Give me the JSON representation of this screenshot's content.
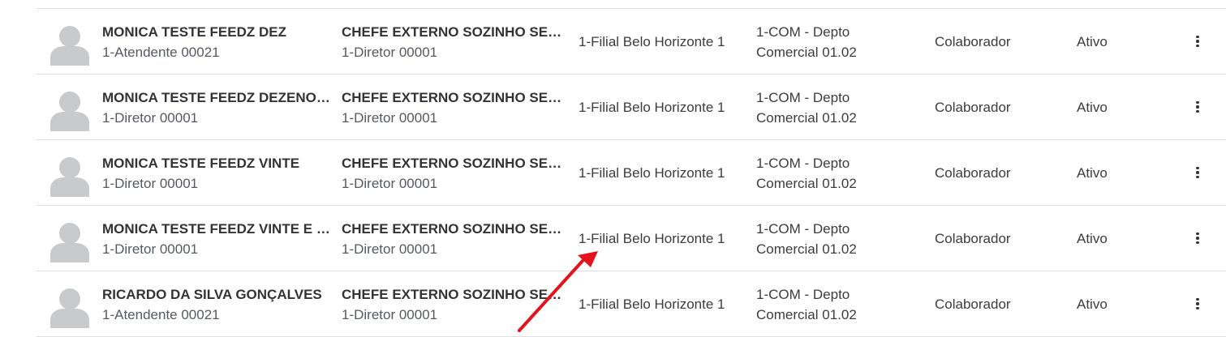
{
  "rows": [
    {
      "name": "MONICA TESTE FEEDZ DEZ",
      "position": "1-Atendente 00021",
      "manager": "CHEFE EXTERNO SOZINHO SEM...",
      "manager_position": "1-Diretor 00001",
      "branch": "1-Filial Belo Horizonte 1",
      "dept_line1": "1-COM - Depto",
      "dept_line2": "Comercial 01.02",
      "role": "Colaborador",
      "status": "Ativo"
    },
    {
      "name": "MONICA TESTE FEEDZ DEZENOVE",
      "position": "1-Diretor 00001",
      "manager": "CHEFE EXTERNO SOZINHO SEM...",
      "manager_position": "1-Diretor 00001",
      "branch": "1-Filial Belo Horizonte 1",
      "dept_line1": "1-COM - Depto",
      "dept_line2": "Comercial 01.02",
      "role": "Colaborador",
      "status": "Ativo"
    },
    {
      "name": "MONICA TESTE FEEDZ VINTE",
      "position": "1-Diretor 00001",
      "manager": "CHEFE EXTERNO SOZINHO SEM...",
      "manager_position": "1-Diretor 00001",
      "branch": "1-Filial Belo Horizonte 1",
      "dept_line1": "1-COM - Depto",
      "dept_line2": "Comercial 01.02",
      "role": "Colaborador",
      "status": "Ativo"
    },
    {
      "name": "MONICA TESTE FEEDZ VINTE E C...",
      "position": "1-Diretor 00001",
      "manager": "CHEFE EXTERNO SOZINHO SEM...",
      "manager_position": "1-Diretor 00001",
      "branch": "1-Filial Belo Horizonte 1",
      "dept_line1": "1-COM - Depto",
      "dept_line2": "Comercial 01.02",
      "role": "Colaborador",
      "status": "Ativo"
    },
    {
      "name": "RICARDO DA SILVA GONÇALVES",
      "position": "1-Atendente 00021",
      "manager": "CHEFE EXTERNO SOZINHO SEM...",
      "manager_position": "1-Diretor 00001",
      "branch": "1-Filial Belo Horizonte 1",
      "dept_line1": "1-COM - Depto",
      "dept_line2": "Comercial 01.02",
      "role": "Colaborador",
      "status": "Ativo"
    }
  ],
  "icons": {
    "avatar": "user-avatar-placeholder-icon",
    "menu": "more-vertical-icon",
    "annotation": "red-arrow-icon"
  },
  "colors": {
    "avatar": "#c9cacc",
    "divider": "#dcdfe3",
    "arrow": "#e3121b"
  }
}
